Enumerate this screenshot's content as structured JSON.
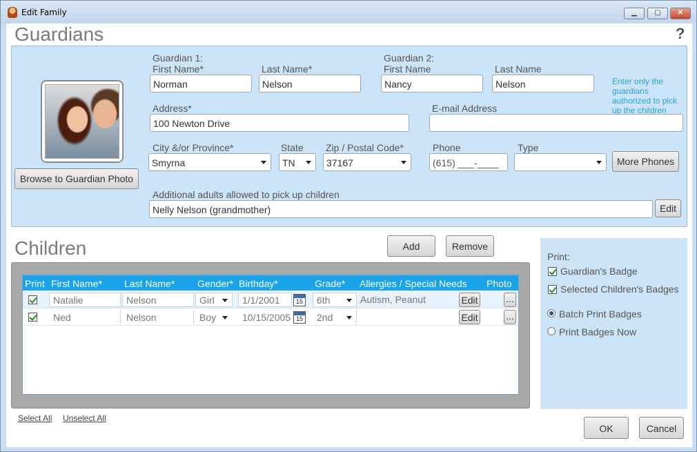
{
  "window": {
    "title": "Edit Family",
    "minimize": "▁",
    "maximize": "▢",
    "close": "✕"
  },
  "guardians": {
    "section_title": "Guardians",
    "help": "?",
    "browse_photo": "Browse to Guardian Photo",
    "g1_heading": "Guardian 1:",
    "g1_first_label": "First Name*",
    "g1_first": "Norman",
    "g1_last_label": "Last Name*",
    "g1_last": "Nelson",
    "g2_heading": "Guardian 2:",
    "g2_first_label": "First Name",
    "g2_first": "Nancy",
    "g2_last_label": "Last Name",
    "g2_last": "Nelson",
    "hint": "Enter only the guardians authorized to pick up the children",
    "address_label": "Address*",
    "address": "100 Newton Drive",
    "email_label": "E-mail Address",
    "email": "",
    "city_label": "City &/or Province*",
    "city": "Smyrna",
    "state_label": "State",
    "state": "TN",
    "zip_label": "Zip / Postal Code*",
    "zip": "37167",
    "phone_label": "Phone",
    "phone": "(615) ___-____",
    "type_label": "Type",
    "type": "",
    "more_phones": "More Phones",
    "additional_label": "Additional adults allowed to pick up children",
    "additional": "Nelly Nelson (grandmother)",
    "additional_edit": "Edit"
  },
  "children": {
    "section_title": "Children",
    "add": "Add",
    "remove": "Remove",
    "headers": [
      "Print",
      "First Name*",
      "Last Name*",
      "Gender*",
      "Birthday*",
      "Grade*",
      "Allergies / Special Needs",
      "Photo"
    ],
    "rows": [
      {
        "print": true,
        "first": "Natalie",
        "last": "Nelson",
        "gender": "Girl",
        "birthday": "1/1/2001",
        "grade": "6th",
        "allergies": "Autism, Peanut",
        "edit": "Edit",
        "photo": "...",
        "cal": "15"
      },
      {
        "print": true,
        "first": "Ned",
        "last": "Nelson",
        "gender": "Boy",
        "birthday": "10/15/2005",
        "grade": "2nd",
        "allergies": "",
        "edit": "Edit",
        "photo": "...",
        "cal": "15"
      }
    ],
    "select_all": "Select All",
    "unselect_all": "Unselect All"
  },
  "print": {
    "label": "Print:",
    "guardian_badge": "Guardian's Badge",
    "children_badges": "Selected Children's Badges",
    "batch": "Batch Print Badges",
    "now": "Print Badges Now"
  },
  "footer": {
    "ok": "OK",
    "cancel": "Cancel"
  }
}
